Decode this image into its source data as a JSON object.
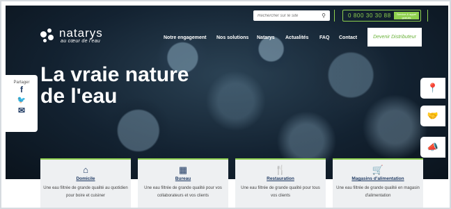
{
  "header": {
    "search": {
      "placeholder": "Rechercher sur le site"
    },
    "phone": {
      "number": "0 800 30 30 88",
      "badge": "Service & appel gratuits"
    },
    "logo": {
      "brand": "natarys",
      "tagline": "au cœur de l'eau"
    },
    "nav": [
      {
        "label": "Notre engagement"
      },
      {
        "label": "Nos solutions"
      },
      {
        "label": "Natarys"
      },
      {
        "label": "Actualités"
      },
      {
        "label": "FAQ"
      },
      {
        "label": "Contact"
      }
    ],
    "cta_label": "Devenir Distributeur"
  },
  "hero": {
    "title_line1": "La vraie nature",
    "title_line2": "de l'eau"
  },
  "share": {
    "label": "Partager",
    "icons": [
      {
        "name": "facebook-icon",
        "glyph": "f"
      },
      {
        "name": "twitter-icon",
        "glyph": "🐦"
      },
      {
        "name": "email-icon",
        "glyph": "✉"
      }
    ]
  },
  "side_buttons": [
    {
      "name": "location-pin-icon",
      "glyph": "📍"
    },
    {
      "name": "handshake-icon",
      "glyph": "🤝"
    },
    {
      "name": "megaphone-icon",
      "glyph": "📣"
    }
  ],
  "cards": [
    {
      "icon": "house-icon",
      "glyph": "⌂",
      "title": "Domicile",
      "desc": "Une eau filtrée de grande qualité au quotidien pour boire et cuisiner"
    },
    {
      "icon": "office-building-icon",
      "glyph": "▦",
      "title": "Bureau",
      "desc": "Une eau filtrée de grande qualité pour vos collaborateurs et vos clients"
    },
    {
      "icon": "cutlery-icon",
      "glyph": "🍴",
      "title": "Restauration",
      "desc": "Une eau filtrée de grande qualité pour tous vos clients"
    },
    {
      "icon": "shopping-cart-icon",
      "glyph": "🛒",
      "title": "Magasins d'alimentation",
      "desc": "Une eau filtrée de grande qualité en magasin d'alimentation"
    }
  ],
  "colors": {
    "accent_green": "#8fd14f",
    "navy": "#1f3a63"
  }
}
